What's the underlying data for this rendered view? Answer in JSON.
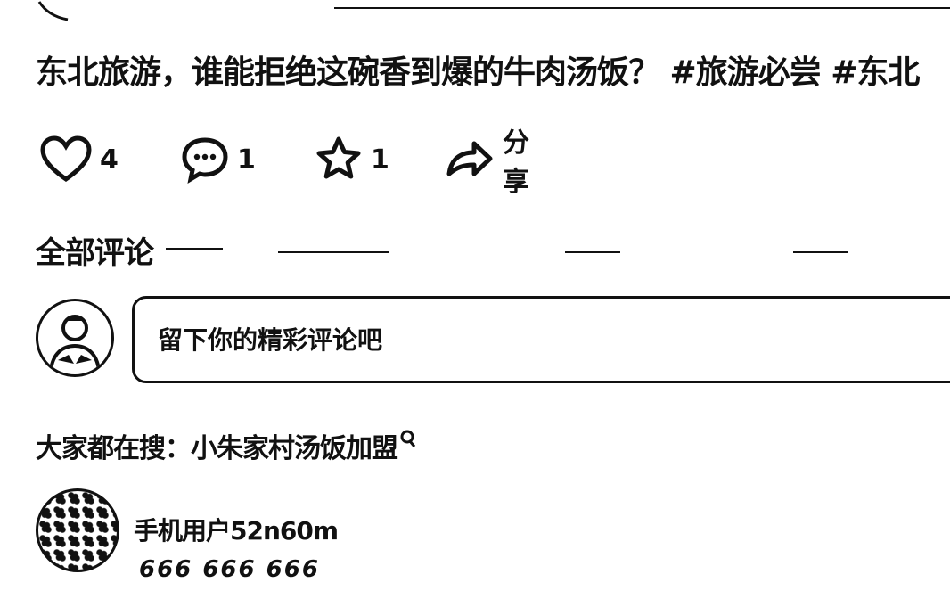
{
  "post": {
    "title": "东北旅游，谁能拒绝这碗香到爆的牛肉汤饭？ #旅游必尝 #东北"
  },
  "actions": {
    "like_count": "4",
    "comment_count": "1",
    "favorite_count": "1",
    "share_label": "分享"
  },
  "comments": {
    "section_title": "全部评论",
    "input_placeholder": "留下你的精彩评论吧",
    "search_prefix": "大家都在搜：",
    "search_term": "小朱家村汤饭加盟",
    "items": [
      {
        "username": "手机用户52n60m",
        "text": "666 666 666"
      }
    ]
  },
  "icons": {
    "like": "heart-icon",
    "comment": "comment-bubble-icon",
    "favorite": "star-icon",
    "share": "share-arrow-icon",
    "search": "search-icon"
  }
}
